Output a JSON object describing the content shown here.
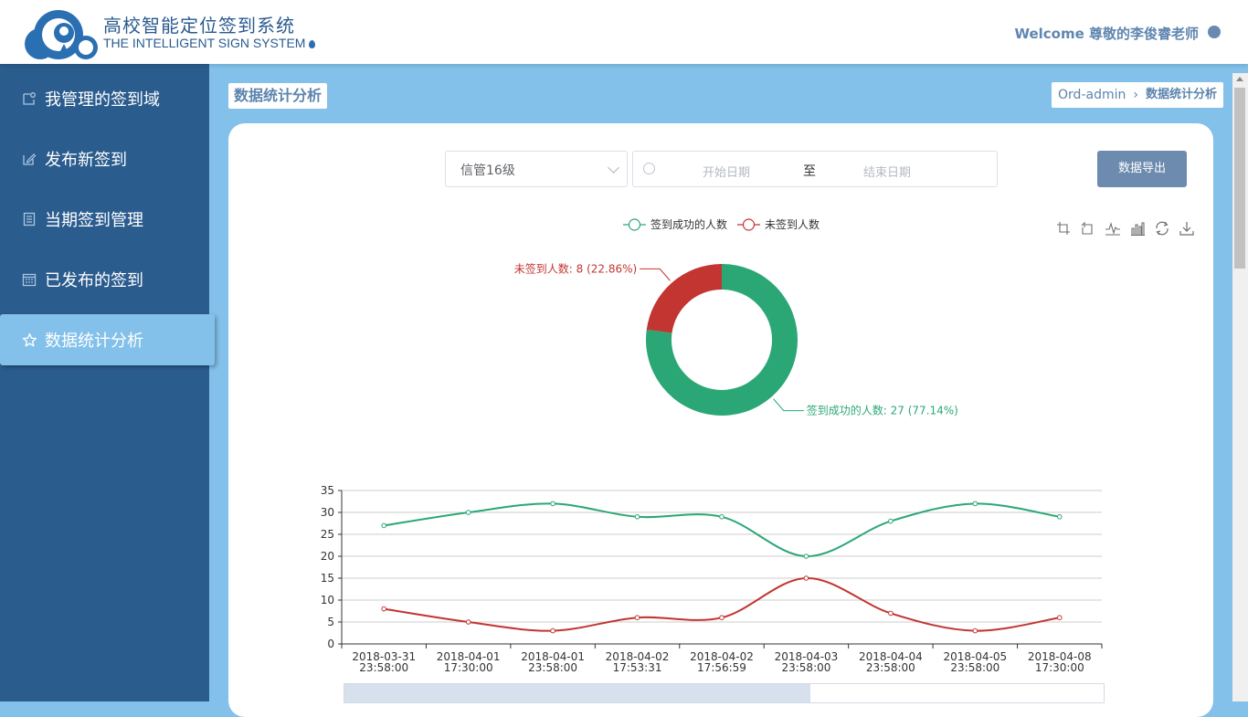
{
  "header": {
    "title": "高校智能定位签到系统",
    "subtitle": "THE INTELLIGENT SIGN SYSTEM",
    "welcome": "Welcome 尊敬的李俊睿老师"
  },
  "sidebar": {
    "items": [
      {
        "label": "我管理的签到域",
        "icon": "location-domain-icon"
      },
      {
        "label": "发布新签到",
        "icon": "edit-icon"
      },
      {
        "label": "当期签到管理",
        "icon": "list-icon"
      },
      {
        "label": "已发布的签到",
        "icon": "calendar-icon"
      },
      {
        "label": "数据统计分析",
        "icon": "star-icon",
        "active": true
      }
    ]
  },
  "page": {
    "title": "数据统计分析",
    "breadcrumb": [
      "Ord-admin",
      "数据统计分析"
    ]
  },
  "filters": {
    "class_select": "信管16级",
    "start_placeholder": "开始日期",
    "range_separator": "至",
    "end_placeholder": "结束日期",
    "export_label": "数据导出"
  },
  "colors": {
    "success": "#2ba775",
    "absent": "#c23531",
    "accent": "#2b5c8e",
    "highlight": "#83c1ea"
  },
  "chart_data": [
    {
      "type": "pie",
      "legend": [
        "签到成功的人数",
        "未签到人数"
      ],
      "slices": [
        {
          "name": "签到成功的人数",
          "value": 27,
          "label": "签到成功的人数: 27 (77.14%)"
        },
        {
          "name": "未签到人数",
          "value": 8,
          "label": "未签到人数: 8 (22.86%)"
        }
      ]
    },
    {
      "type": "line",
      "x": [
        [
          "2018-03-31",
          "23:58:00"
        ],
        [
          "2018-04-01",
          "17:30:00"
        ],
        [
          "2018-04-01",
          "23:58:00"
        ],
        [
          "2018-04-02",
          "17:53:31"
        ],
        [
          "2018-04-02",
          "17:56:59"
        ],
        [
          "2018-04-03",
          "23:58:00"
        ],
        [
          "2018-04-04",
          "23:58:00"
        ],
        [
          "2018-04-05",
          "23:58:00"
        ],
        [
          "2018-04-08",
          "17:30:00"
        ]
      ],
      "series": [
        {
          "name": "签到成功的人数",
          "values": [
            27,
            30,
            32,
            29,
            29,
            20,
            28,
            32,
            29
          ]
        },
        {
          "name": "未签到人数",
          "values": [
            8,
            5,
            3,
            6,
            6,
            15,
            7,
            3,
            6
          ]
        }
      ],
      "ylim": [
        0,
        35
      ],
      "yticks": [
        "0",
        "5",
        "10",
        "15",
        "20",
        "25",
        "30",
        "35"
      ],
      "grid": true
    }
  ]
}
